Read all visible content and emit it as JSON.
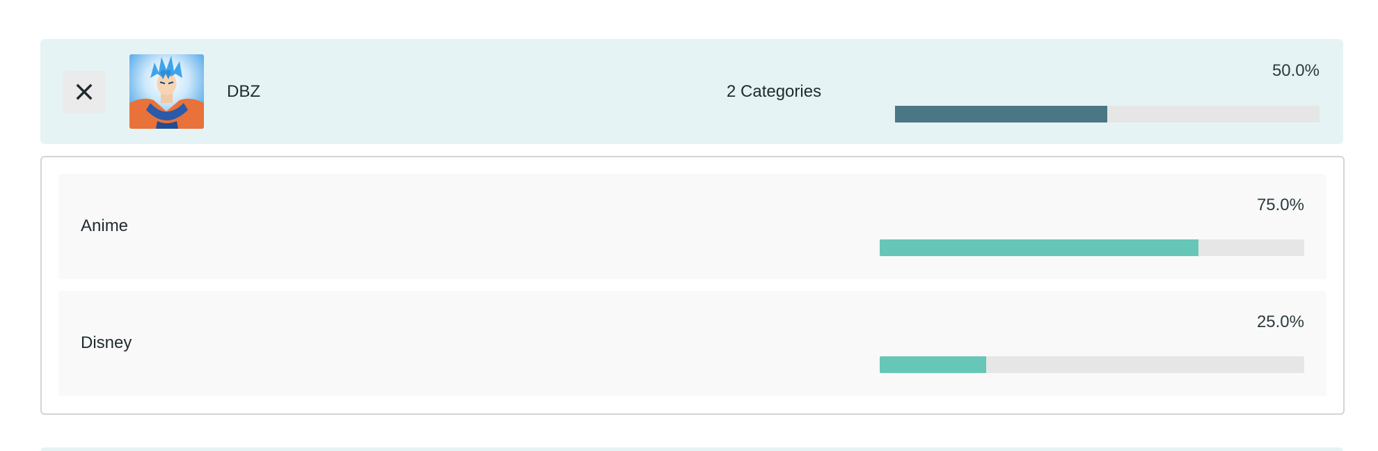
{
  "colors": {
    "group_background": "#e6f3f4",
    "group_bar_fill": "#4a7783",
    "category_bar_fill": "#66c6b7",
    "bar_track": "#e6e6e6",
    "category_background": "#f9f9f9"
  },
  "group": {
    "close_icon": "close-icon",
    "thumbnail": "goku-avatar",
    "name": "DBZ",
    "category_count": "2 Categories",
    "percent_label": "50.0%",
    "percent_value": 50.0
  },
  "categories": [
    {
      "label": "Anime",
      "percent_label": "75.0%",
      "percent_value": 75.0
    },
    {
      "label": "Disney",
      "percent_label": "25.0%",
      "percent_value": 25.0
    }
  ]
}
